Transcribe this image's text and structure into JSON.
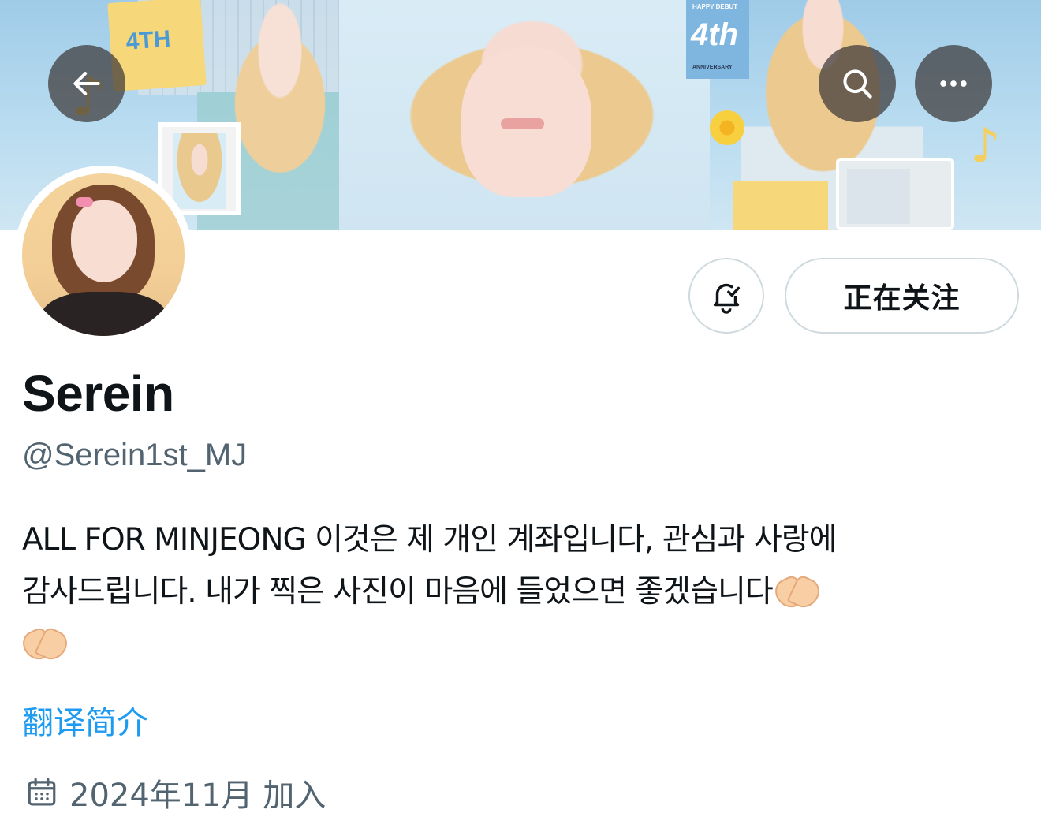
{
  "banner": {
    "note_text": "4TH",
    "tile_text": "4th",
    "tile_top": "HAPPY DEBUT",
    "tile_bottom": "ANNIVERSARY"
  },
  "toolbar": {
    "back_icon": "arrow-left-icon",
    "search_icon": "search-icon",
    "more_icon": "more-horizontal-icon"
  },
  "actions": {
    "notify_icon": "bell-check-icon",
    "follow_label": "正在关注"
  },
  "profile": {
    "display_name": "Serein",
    "handle": "@Serein1st_MJ",
    "bio_line1": "ALL FOR MINJEONG 이것은 제 개인 계좌입니다, 관심과 사랑에",
    "bio_line2": "감사드립니다. 내가 찍은 사진이 마음에 들었으면 좋겠습니다",
    "bio_emoji": "heart-hands-emoji",
    "translate_label": "翻译简介",
    "joined_icon": "calendar-icon",
    "joined_text": "2024年11月 加入"
  },
  "colors": {
    "link": "#1d9bf0",
    "secondary_text": "#536471",
    "primary_text": "#0f1419",
    "button_border": "#cfd9de"
  }
}
